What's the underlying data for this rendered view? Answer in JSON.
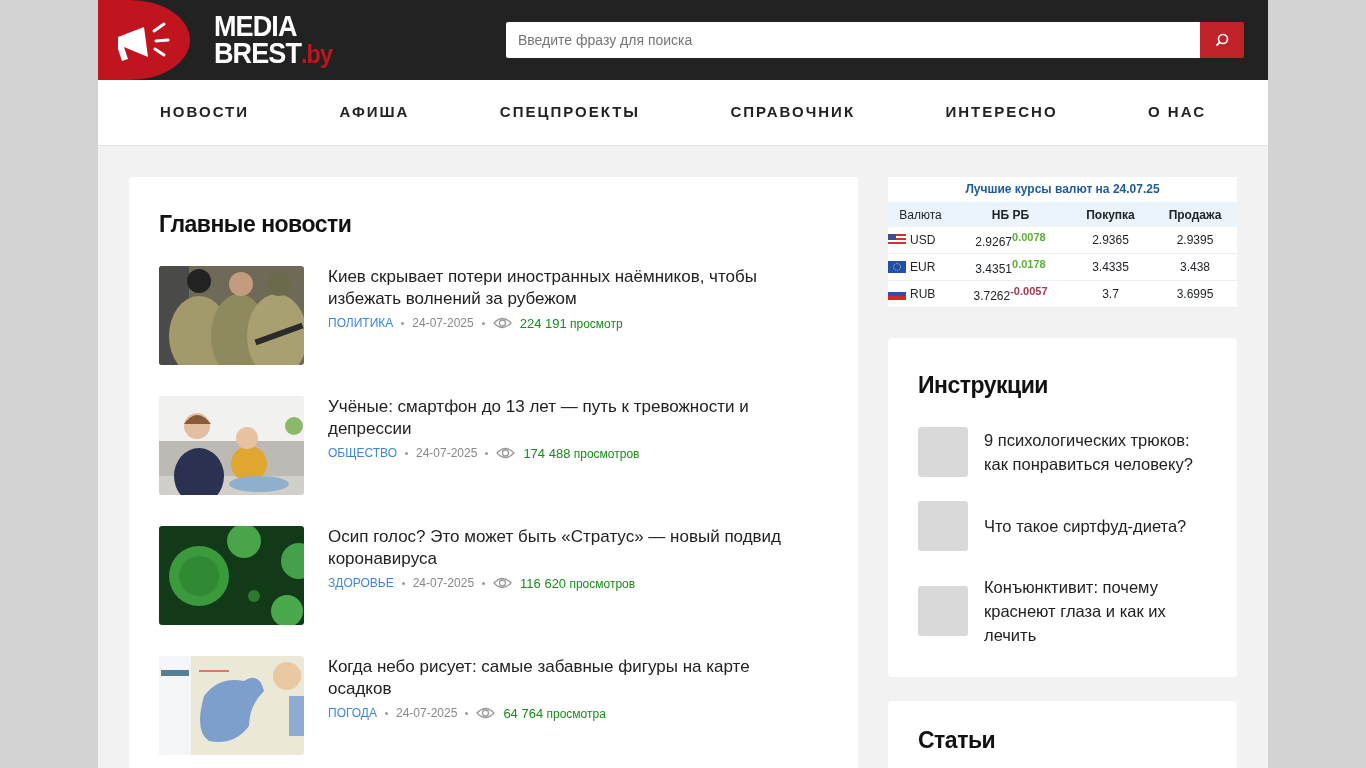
{
  "header": {
    "logo": {
      "name": "MEDIA",
      "name2": "BREST",
      "domain": ".by"
    },
    "search": {
      "placeholder": "Введите фразу для поиска"
    }
  },
  "nav": [
    "НОВОСТИ",
    "АФИША",
    "СПЕЦПРОЕКТЫ",
    "СПРАВОЧНИК",
    "ИНТЕРЕСНО",
    "О НАС"
  ],
  "main_news": {
    "title": "Главные новости",
    "items": [
      {
        "title": "Киев скрывает потери иностранных наёмников, чтобы избежать волнений за рубежом",
        "category": "ПОЛИТИКА",
        "date": "24-07-2025",
        "views": "224 191",
        "views_label": "просмотр"
      },
      {
        "title": "Учёные: смартфон до 13 лет — путь к тревожности и депрессии",
        "category": "ОБЩЕСТВО",
        "date": "24-07-2025",
        "views": "174 488",
        "views_label": "просмотров"
      },
      {
        "title": "Осип голос? Это может быть «Стратус» — новый подвид коронавируса",
        "category": "ЗДОРОВЬЕ",
        "date": "24-07-2025",
        "views": "116 620",
        "views_label": "просмотров"
      },
      {
        "title": "Когда небо рисует: самые забавные фигуры на карте осадков",
        "category": "ПОГОДА",
        "date": "24-07-2025",
        "views": "64 764",
        "views_label": "просмотра"
      }
    ]
  },
  "currency": {
    "title": "Лучшие курсы валют на 24.07.25",
    "columns": [
      "Валюта",
      "НБ РБ",
      "Покупка",
      "Продажа"
    ],
    "rows": [
      {
        "code": "USD",
        "nbrb": "2.9267",
        "change": "0.0078",
        "color": "#5cae32",
        "buy": "2.9365",
        "sell": "2.9395"
      },
      {
        "code": "EUR",
        "nbrb": "3.4351",
        "change": "0.0178",
        "color": "#5cae32",
        "buy": "3.4335",
        "sell": "3.438"
      },
      {
        "code": "RUB",
        "nbrb": "3.7262",
        "change": "-0.0057",
        "color": "#a3374b",
        "buy": "3.7",
        "sell": "3.6995"
      }
    ]
  },
  "instructions": {
    "title": "Инструкции",
    "items": [
      "9 психологических трюков: как понравиться человеку?",
      "Что такое сиртфуд-диета?",
      "Конъюнктивит: почему краснеют глаза и как их лечить"
    ]
  },
  "articles": {
    "title": "Статьи"
  }
}
